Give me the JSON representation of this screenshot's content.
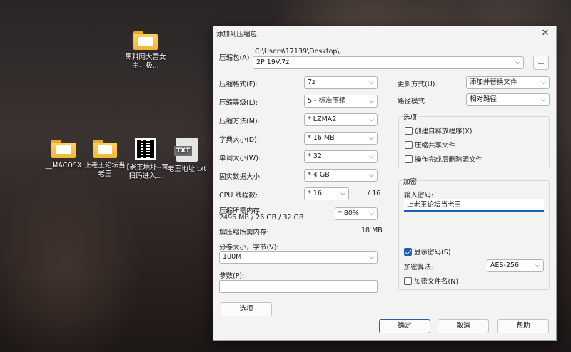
{
  "desktop": {
    "icons": [
      {
        "label": "黑料网大雷女主，极..."
      },
      {
        "label": "__MACOSX"
      },
      {
        "label": "上老王论坛当老王"
      },
      {
        "label": "【老王地址--可扫码进入..."
      },
      {
        "label": "老王地址.txt"
      }
    ],
    "txt_badge": "TXT"
  },
  "dialog": {
    "title": "添加到压缩包",
    "close_glyph": "✕",
    "archive_label": "压缩包(A)",
    "archive_path": "C:\\Users\\17139\\Desktop\\",
    "archive_name": "2P 19V.7z",
    "browse_label": "...",
    "format_label": "压缩格式(F):",
    "format_value": "7z",
    "level_label": "压缩等级(L):",
    "level_value": "5 - 标准压缩",
    "method_label": "压缩方法(M):",
    "method_value": "* LZMA2",
    "dict_label": "字典大小(D):",
    "dict_value": "* 16 MB",
    "word_label": "单词大小(W):",
    "word_value": "* 32",
    "solid_label": "固实数据大小:",
    "solid_value": "* 4 GB",
    "threads_label": "CPU 线程数:",
    "threads_value": "* 16",
    "threads_max": "/ 16",
    "mem_label": "压缩所需内存:",
    "mem_detail": "2496 MB / 26 GB / 32 GB",
    "mem_value": "* 80%",
    "decomp_label": "解压缩所需内存:",
    "decomp_value": "18 MB",
    "split_label": "分卷大小，字节(V):",
    "split_value": "100M",
    "params_label": "参数(P):",
    "params_value": "",
    "options_button": "选项",
    "update_label": "更新方式(U):",
    "update_value": "添加并替换文件",
    "pathmode_label": "路径模式",
    "pathmode_value": "相对路径",
    "options_group": "选项",
    "opt_sfx": "创建自释放程序(X)",
    "opt_shared": "压缩共享文件",
    "opt_delete": "操作完成后删除源文件",
    "encrypt_group": "加密",
    "password_label": "输入密码:",
    "password_value": "上老王论坛当老王",
    "show_password": "显示密码(S)",
    "enc_method_label": "加密算法:",
    "enc_method_value": "AES-256",
    "enc_names": "加密文件名(N)",
    "ok": "确定",
    "cancel": "取消",
    "help": "帮助",
    "arrow_glyph": "⌵"
  }
}
